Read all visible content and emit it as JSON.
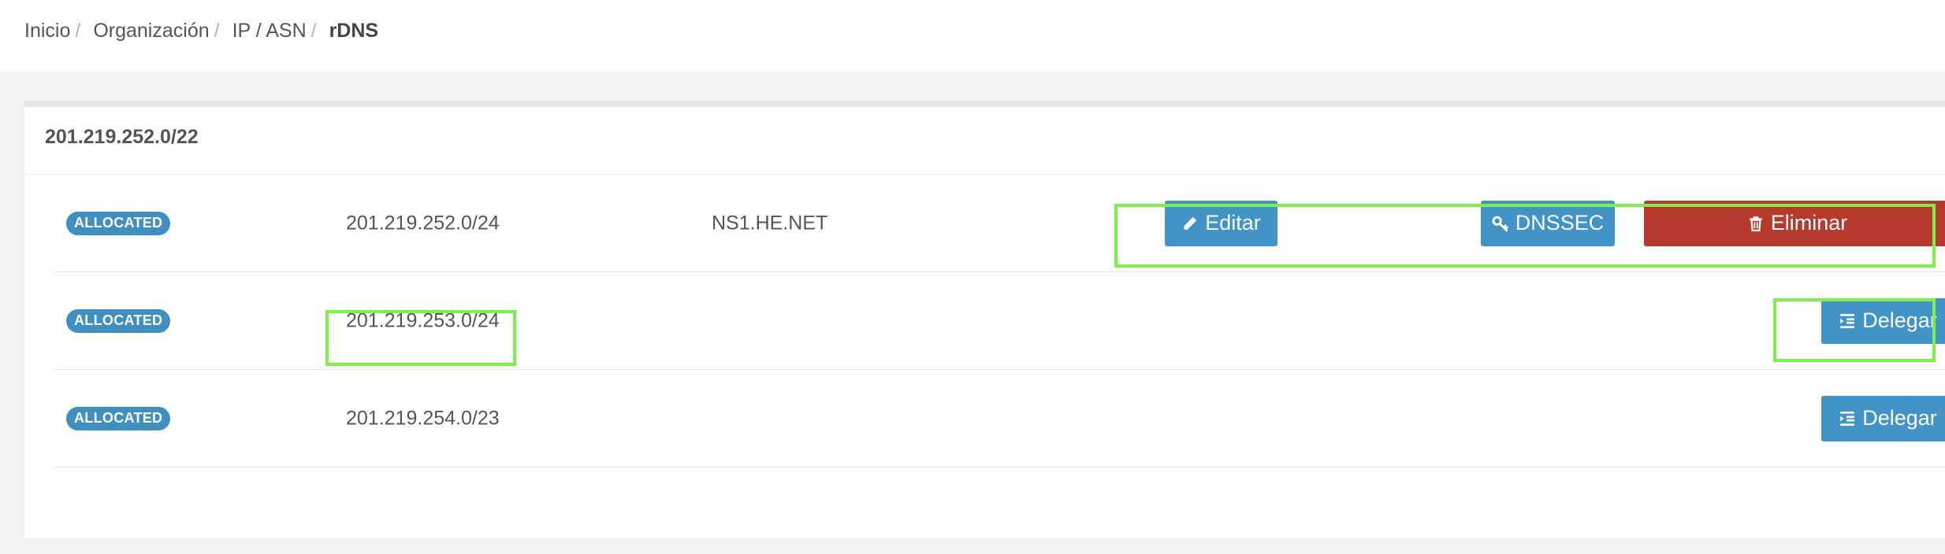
{
  "breadcrumb": {
    "items": [
      "Inicio",
      "Organización",
      "IP / ASN"
    ],
    "current": "rDNS",
    "separator": "/"
  },
  "card": {
    "title": "201.219.252.0/22"
  },
  "rows": [
    {
      "status": "ALLOCATED",
      "prefix": "201.219.252.0/24",
      "nameserver": "NS1.HE.NET",
      "actions": {
        "edit_label": "Editar",
        "dnssec_label": "DNSSEC",
        "delete_label": "Eliminar"
      }
    },
    {
      "status": "ALLOCATED",
      "prefix": "201.219.253.0/24",
      "nameserver": "",
      "actions": {
        "delegate_label": "Delegar"
      }
    },
    {
      "status": "ALLOCATED",
      "prefix": "201.219.254.0/23",
      "nameserver": "",
      "actions": {
        "delegate_label": "Delegar"
      }
    }
  ],
  "colors": {
    "badge": "#3f8fc0",
    "button_primary": "#4293c7",
    "button_danger": "#b63a2e",
    "highlight": "#7df04e"
  },
  "icons": {
    "edit": "pencil-icon",
    "dnssec": "key-icon",
    "delete": "trash-icon",
    "delegate": "indent-list-icon"
  }
}
